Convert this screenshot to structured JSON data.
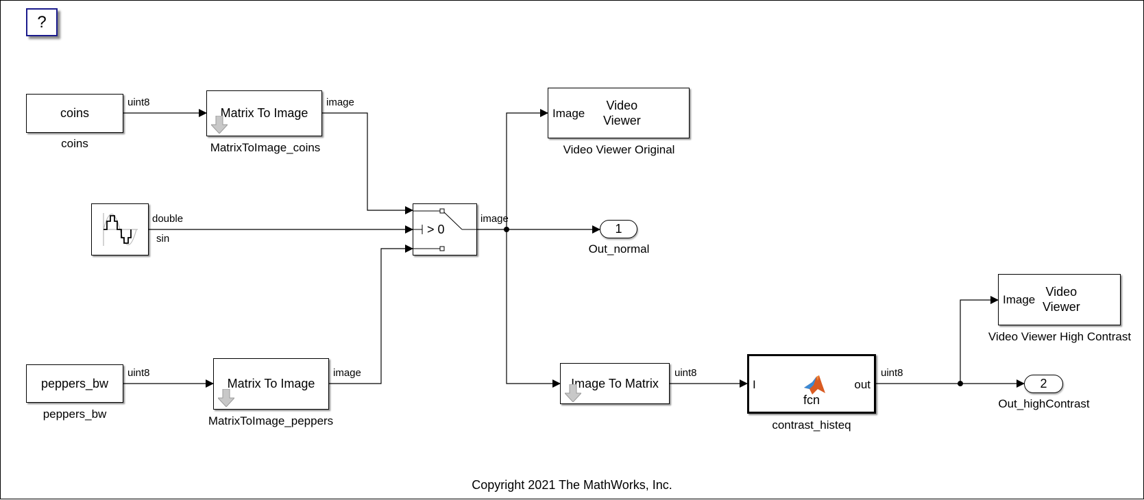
{
  "help_button": {
    "label": "?"
  },
  "blocks": {
    "coins": {
      "text": "coins",
      "name": "coins"
    },
    "matrix_to_image_coins": {
      "text": "Matrix To Image",
      "name": "MatrixToImage_coins"
    },
    "sine": {
      "name": "sin"
    },
    "switch": {
      "text": "> 0"
    },
    "video_viewer_original": {
      "port": "Image",
      "text_line1": "Video",
      "text_line2": "Viewer",
      "name": "Video Viewer Original"
    },
    "out_normal": {
      "number": "1",
      "name": "Out_normal"
    },
    "peppers_bw": {
      "text": "peppers_bw",
      "name": "peppers_bw"
    },
    "matrix_to_image_peppers": {
      "text": "Matrix To Image",
      "name": "MatrixToImage_peppers"
    },
    "image_to_matrix": {
      "text": "Image To Matrix"
    },
    "contrast_histeq": {
      "in_port": "I",
      "out_port": "out",
      "text": "fcn",
      "name": "contrast_histeq"
    },
    "video_viewer_high_contrast": {
      "port": "Image",
      "text_line1": "Video",
      "text_line2": "Viewer",
      "name": "Video Viewer High Contrast"
    },
    "out_high_contrast": {
      "number": "2",
      "name": "Out_highContrast"
    }
  },
  "signals": {
    "coins_out": "uint8",
    "m2i_coins_out": "image",
    "sine_type": "double",
    "sine_name": "sin",
    "switch_out": "image",
    "peppers_out": "uint8",
    "m2i_peppers_out": "image",
    "i2m_out": "uint8",
    "histeq_out": "uint8"
  },
  "footer": {
    "copyright": "Copyright 2021 The MathWorks, Inc."
  }
}
